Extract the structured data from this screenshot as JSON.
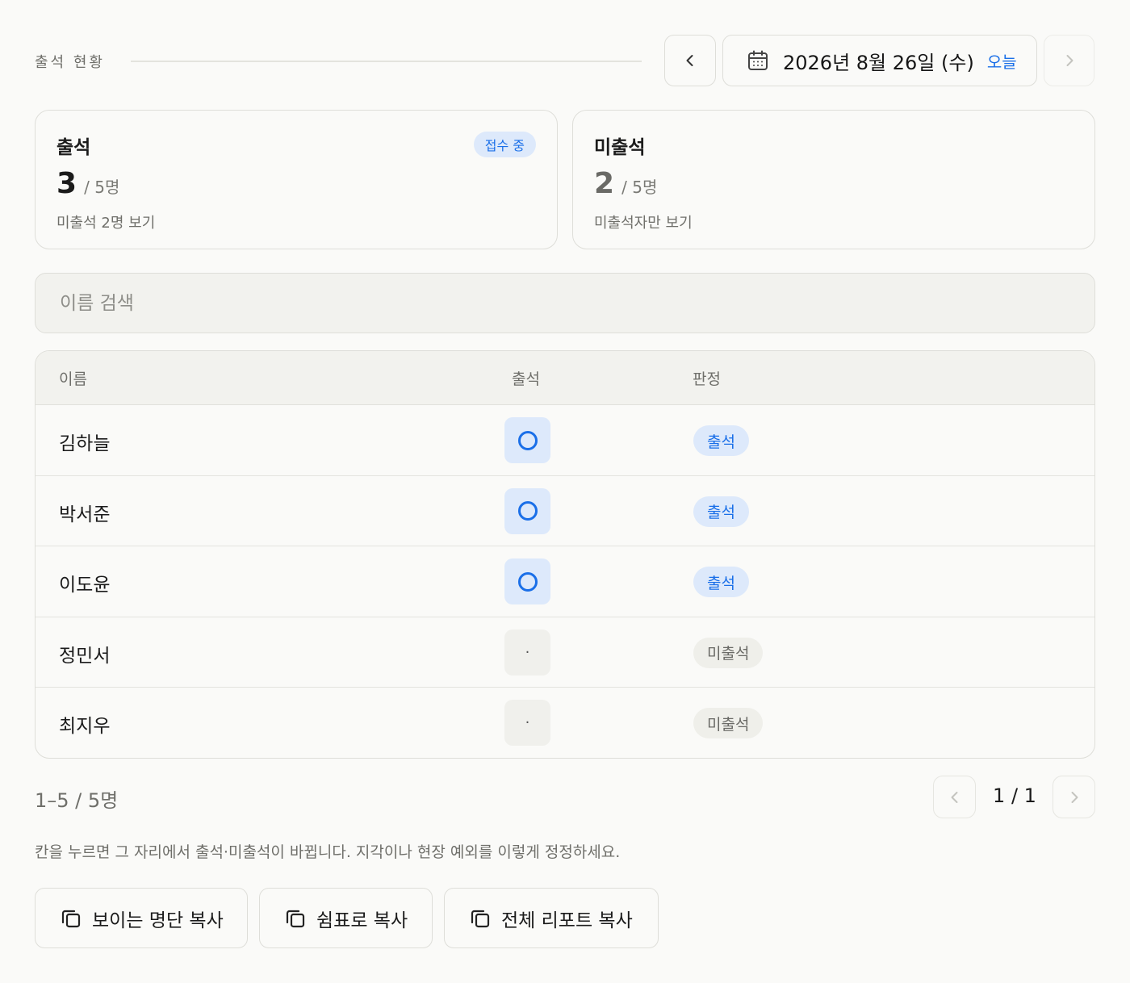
{
  "header": {
    "section_title": "출석 현황",
    "date": "2026년 8월 26일 (수)",
    "today_label": "오늘",
    "icons": {
      "prev": "chevron-left-icon",
      "next": "chevron-right-icon",
      "calendar": "calendar-icon"
    }
  },
  "stats": {
    "present": {
      "label": "출석",
      "badge": "접수 중",
      "count": "3",
      "total": "/ 5명",
      "link": "미출석 2명 보기"
    },
    "absent": {
      "label": "미출석",
      "count": "2",
      "total": "/ 5명",
      "link": "미출석자만 보기"
    }
  },
  "search": {
    "placeholder": "이름 검색",
    "value": ""
  },
  "table": {
    "headers": [
      "이름",
      "출석",
      "판정"
    ],
    "rows": [
      {
        "name": "김하늘",
        "attendance": "O",
        "verdict": "출석"
      },
      {
        "name": "박서준",
        "attendance": "O",
        "verdict": "출석"
      },
      {
        "name": "이도윤",
        "attendance": "O",
        "verdict": "출석"
      },
      {
        "name": "정민서",
        "attendance": "·",
        "verdict": "미출석"
      },
      {
        "name": "최지우",
        "attendance": "·",
        "verdict": "미출석"
      }
    ]
  },
  "pagination": {
    "range": "1–5 / 5명",
    "page": "1 / 1"
  },
  "hint": "칸을 누르면 그 자리에서 출석·미출석이 바뀝니다. 지각이나 현장 예외를 이렇게 정정하세요.",
  "actions": {
    "copy_visible": "보이는 명단 복사",
    "copy_csv": "쉼표로 복사",
    "copy_report": "전체 리포트 복사",
    "icon": "copy-icon"
  },
  "colors": {
    "accent": "#1a6fe8",
    "accent_bg": "#dde9fb",
    "background": "#fafaf8"
  }
}
